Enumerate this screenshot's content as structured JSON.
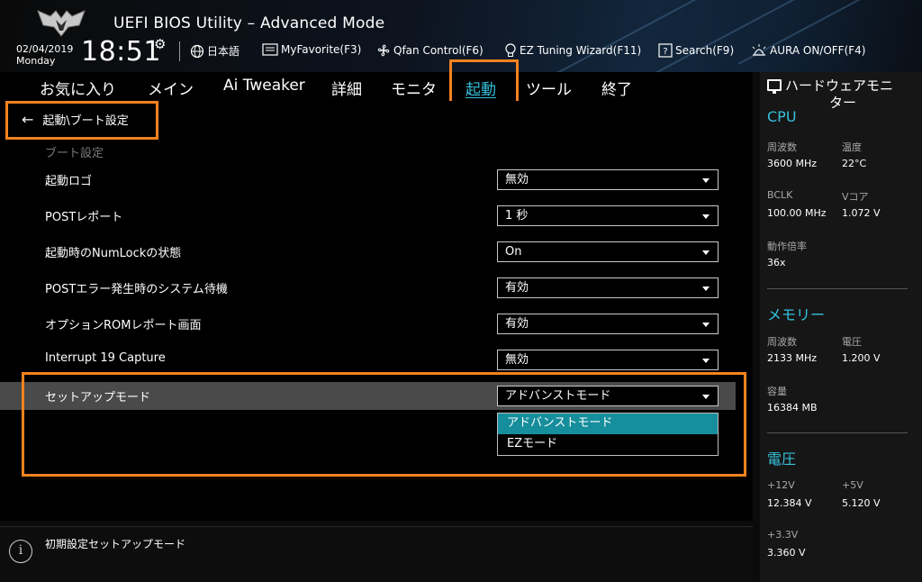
{
  "header": {
    "title": "UEFI BIOS Utility – Advanced Mode",
    "date": "02/04/2019",
    "day": "Monday",
    "time": "18:51",
    "toolbar": [
      {
        "label": "日本語",
        "icon": "globe-icon"
      },
      {
        "label": "MyFavorite(F3)",
        "icon": "favorite-list-icon"
      },
      {
        "label": "Qfan Control(F6)",
        "icon": "fan-icon"
      },
      {
        "label": "EZ Tuning Wizard(F11)",
        "icon": "lightbulb-icon"
      },
      {
        "label": "Search(F9)",
        "icon": "search-icon"
      },
      {
        "label": "AURA ON/OFF(F4)",
        "icon": "aura-light-icon"
      }
    ]
  },
  "tabs": [
    {
      "label": "お気に入り",
      "active": false
    },
    {
      "label": "メイン",
      "active": false
    },
    {
      "label": "Ai Tweaker",
      "active": false
    },
    {
      "label": "詳細",
      "active": false
    },
    {
      "label": "モニタ",
      "active": false
    },
    {
      "label": "起動",
      "active": true
    },
    {
      "label": "ツール",
      "active": false
    },
    {
      "label": "終了",
      "active": false
    }
  ],
  "main": {
    "breadcrumb": "起動\\ブート設定",
    "section_label": "ブート設定",
    "settings": [
      {
        "label": "起動ロゴ",
        "value": "無効"
      },
      {
        "label": "POSTレポート",
        "value": "1 秒"
      },
      {
        "label": "起動時のNumLockの状態",
        "value": "On"
      },
      {
        "label": "POSTエラー発生時のシステム待機",
        "value": "有効"
      },
      {
        "label": "オプションROMレポート画面",
        "value": "有効"
      },
      {
        "label": "Interrupt 19 Capture",
        "value": "無効"
      },
      {
        "label": "セットアップモード",
        "value": "アドバンストモード"
      }
    ],
    "dropdown_options": [
      {
        "label": "アドバンストモード",
        "selected": true
      },
      {
        "label": "EZモード",
        "selected": false
      }
    ]
  },
  "help": {
    "text": "初期設定セットアップモード"
  },
  "hw_monitor": {
    "title_line1": "ハードウェアモニ",
    "title_line2": "ター",
    "cpu": {
      "heading": "CPU",
      "freq_label": "周波数",
      "freq_value": "3600 MHz",
      "temp_label": "温度",
      "temp_value": "22°C",
      "bclk_label": "BCLK",
      "bclk_value": "100.00 MHz",
      "vcore_label": "Vコア",
      "vcore_value": "1.072 V",
      "ratio_label": "動作倍率",
      "ratio_value": "36x"
    },
    "memory": {
      "heading": "メモリー",
      "freq_label": "周波数",
      "freq_value": "2133 MHz",
      "volt_label": "電圧",
      "volt_value": "1.200 V",
      "cap_label": "容量",
      "cap_value": "16384 MB"
    },
    "voltage": {
      "heading": "電圧",
      "v12_label": "+12V",
      "v12_value": "12.384 V",
      "v5_label": "+5V",
      "v5_value": "5.120 V",
      "v33_label": "+3.3V",
      "v33_value": "3.360 V"
    }
  },
  "colors": {
    "accent": "#36c1dd",
    "highlight_box": "#f5821f",
    "dropdown_selected": "#168e9c",
    "row_highlight": "#4a4a4a"
  }
}
